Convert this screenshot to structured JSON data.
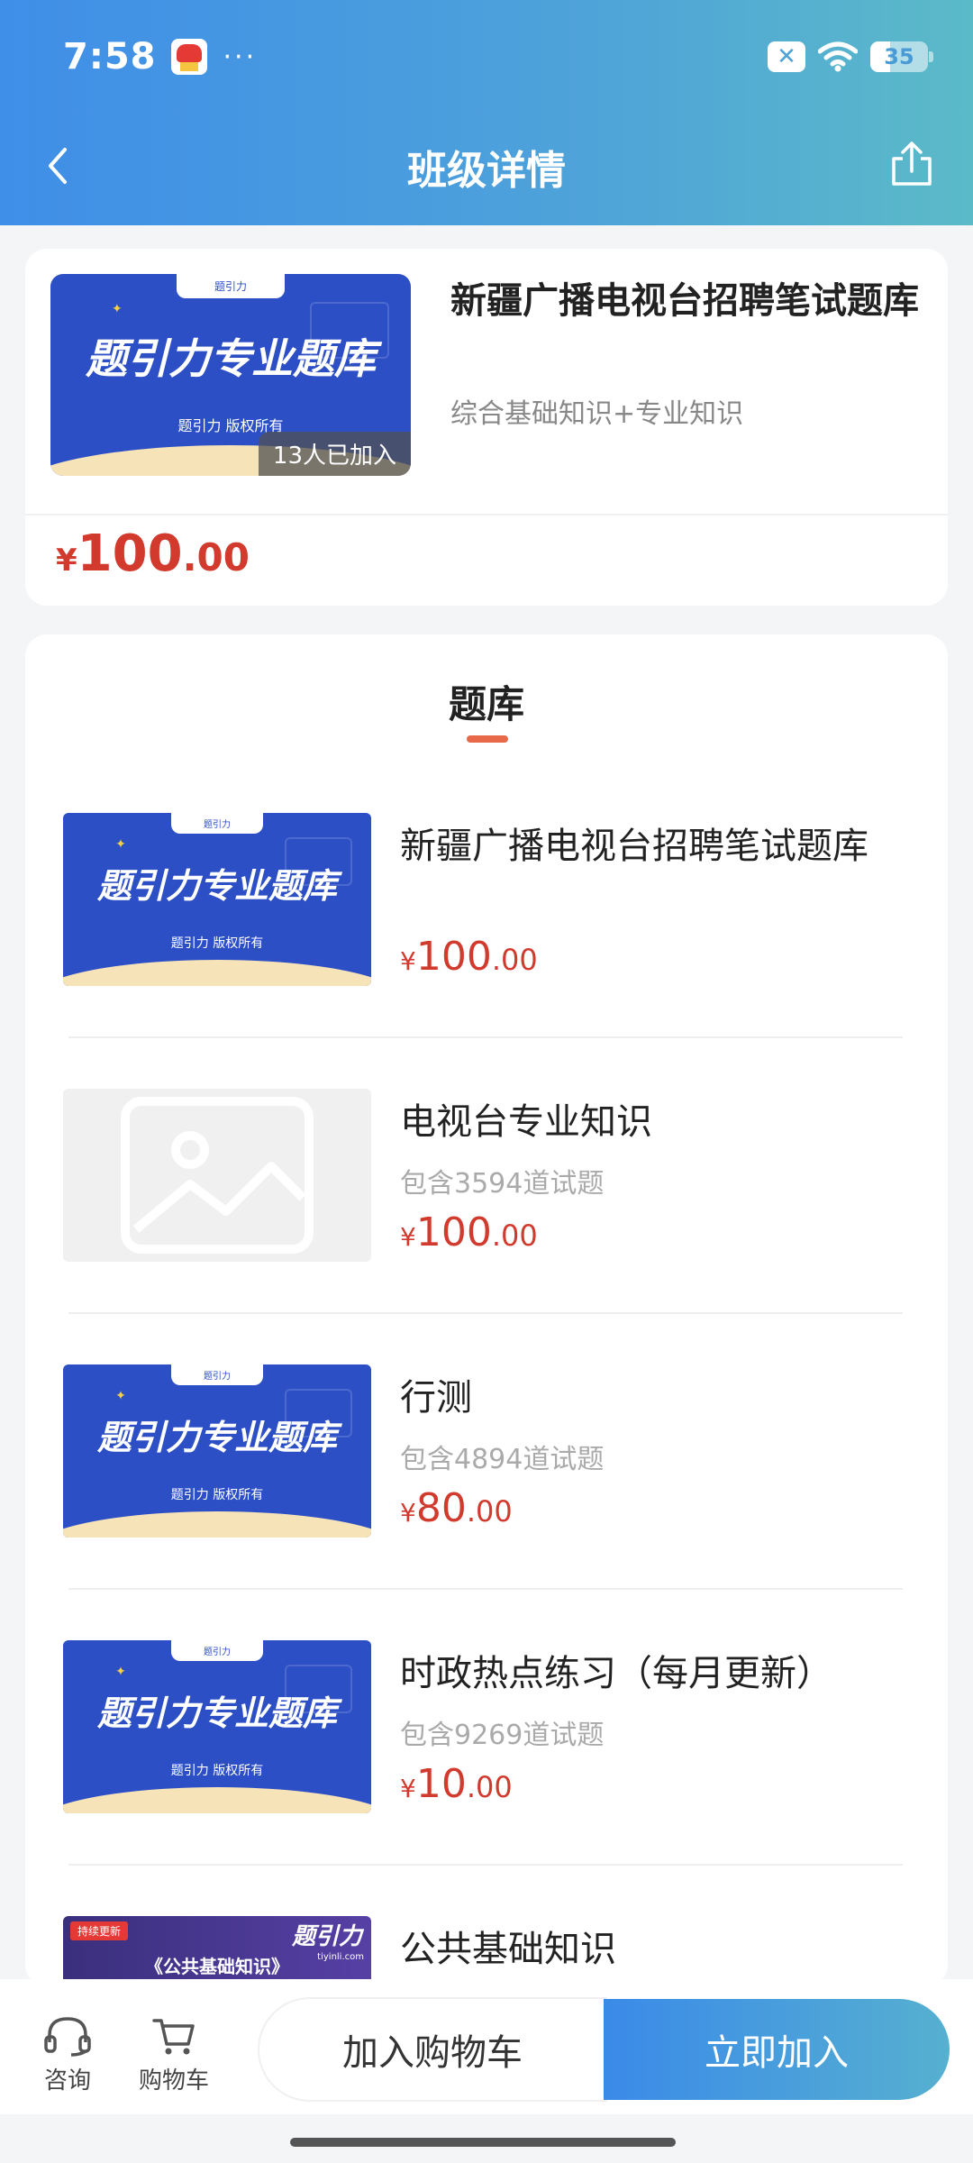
{
  "status_bar": {
    "time": "7:58",
    "dots": "···",
    "battery": "35"
  },
  "nav": {
    "title": "班级详情"
  },
  "course": {
    "title": "新疆广播电视台招聘笔试题库",
    "subtitle": "综合基础知识+专业知识",
    "joined": "13人已加入",
    "price": {
      "symbol": "¥",
      "int": "100",
      "dec": ".00"
    },
    "cover": {
      "brand": "题引力",
      "headline": "题引力专业题库",
      "copyright": "题引力 版权所有"
    }
  },
  "bank": {
    "title": "题库",
    "items": [
      {
        "name": "新疆广播电视台招聘笔试题库",
        "count": "",
        "price": {
          "symbol": "¥",
          "int": "100",
          "dec": ".00"
        },
        "cover": "promo"
      },
      {
        "name": "电视台专业知识",
        "count": "包含3594道试题",
        "price": {
          "symbol": "¥",
          "int": "100",
          "dec": ".00"
        },
        "cover": "placeholder"
      },
      {
        "name": "行测",
        "count": "包含4894道试题",
        "price": {
          "symbol": "¥",
          "int": "80",
          "dec": ".00"
        },
        "cover": "promo"
      },
      {
        "name": "时政热点练习（每月更新）",
        "count": "包含9269道试题",
        "price": {
          "symbol": "¥",
          "int": "10",
          "dec": ".00"
        },
        "cover": "promo"
      },
      {
        "name": "公共基础知识",
        "count": "",
        "price": null,
        "cover": "gov"
      }
    ],
    "gov_cover": {
      "tag": "持续更新",
      "logo": "题引力",
      "site": "tiyinli.com",
      "heading": "《公共基础知识》"
    }
  },
  "bottom": {
    "consult": "咨询",
    "cart": "购物车",
    "add_to_cart": "加入购物车",
    "join_now": "立即加入"
  }
}
